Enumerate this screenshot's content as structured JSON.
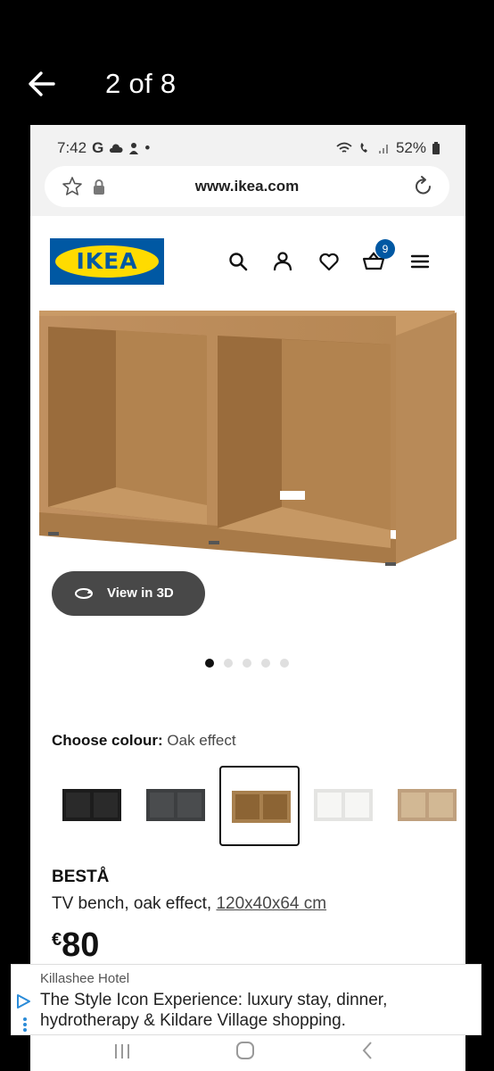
{
  "viewer": {
    "counter": "2 of 8",
    "back_icon": "back-arrow-icon"
  },
  "statusbar": {
    "time": "7:42",
    "carrier_glyph": "G",
    "dot": "•",
    "battery": "52%"
  },
  "browser": {
    "url": "www.ikea.com"
  },
  "header": {
    "logo_text": "IKEA",
    "cart_count": "9",
    "icons": [
      "search-icon",
      "account-icon",
      "heart-icon",
      "cart-icon",
      "hamburger-menu-icon"
    ]
  },
  "product": {
    "view_3d_label": "View in 3D",
    "image_count": 5,
    "active_image_index": 0,
    "colour_label": "Choose colour:",
    "colour_value": "Oak effect",
    "swatches": [
      {
        "name": "black-brown",
        "color": "#1c1c1c"
      },
      {
        "name": "dark-grey",
        "color": "#3d3f41"
      },
      {
        "name": "oak-effect",
        "color": "#a8804e",
        "selected": true
      },
      {
        "name": "white",
        "color": "#f3f3f1"
      },
      {
        "name": "white-stained-oak",
        "color": "#bfa07e"
      }
    ],
    "name": "BESTÅ",
    "description": "TV bench, oak effect,",
    "dimensions": "120x40x64 cm",
    "price_currency": "€",
    "price_amount": "80"
  },
  "ad": {
    "source": "Killashee Hotel",
    "text": "The Style Icon Experience: luxury stay, dinner, hydrotherapy & Kildare Village shopping."
  },
  "colors": {
    "ikea_blue": "#0058a3",
    "ikea_yellow": "#ffdb00",
    "button_dark": "#484848"
  }
}
